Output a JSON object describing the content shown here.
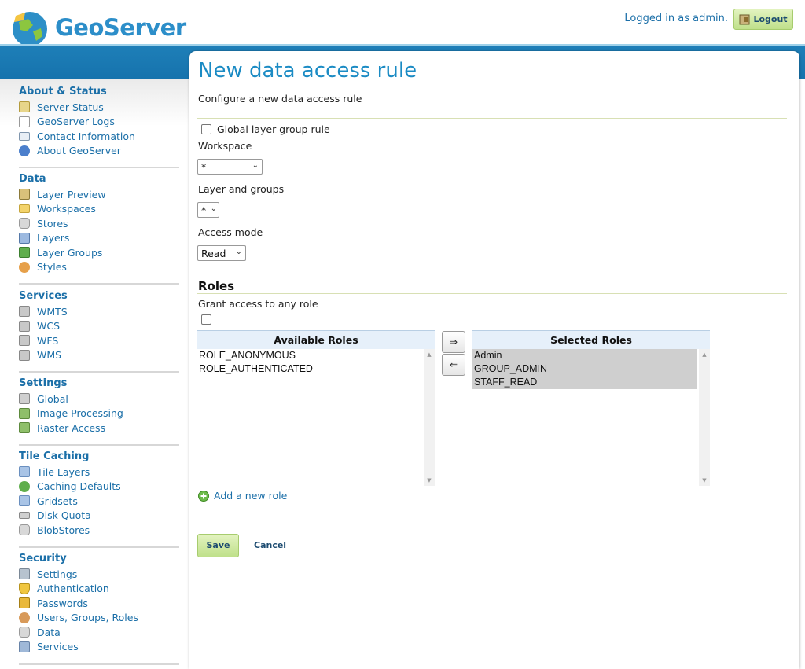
{
  "header": {
    "brand": "GeoServer",
    "login_text": "Logged in as admin.",
    "logout_label": "Logout"
  },
  "sidebar": {
    "sections": [
      {
        "title": "About & Status",
        "items": [
          {
            "label": "Server Status",
            "icon": "server-status-icon"
          },
          {
            "label": "GeoServer Logs",
            "icon": "logs-icon"
          },
          {
            "label": "Contact Information",
            "icon": "contact-card-icon"
          },
          {
            "label": "About GeoServer",
            "icon": "info-icon"
          }
        ]
      },
      {
        "title": "Data",
        "items": [
          {
            "label": "Layer Preview",
            "icon": "map-preview-icon"
          },
          {
            "label": "Workspaces",
            "icon": "folder-icon"
          },
          {
            "label": "Stores",
            "icon": "database-icon"
          },
          {
            "label": "Layers",
            "icon": "layer-icon"
          },
          {
            "label": "Layer Groups",
            "icon": "layer-group-icon"
          },
          {
            "label": "Styles",
            "icon": "palette-icon"
          }
        ]
      },
      {
        "title": "Services",
        "items": [
          {
            "label": "WMTS",
            "icon": "service-wmts-icon"
          },
          {
            "label": "WCS",
            "icon": "service-wcs-icon"
          },
          {
            "label": "WFS",
            "icon": "service-wfs-icon"
          },
          {
            "label": "WMS",
            "icon": "service-wms-icon"
          }
        ]
      },
      {
        "title": "Settings",
        "items": [
          {
            "label": "Global",
            "icon": "server-icon"
          },
          {
            "label": "Image Processing",
            "icon": "image-icon"
          },
          {
            "label": "Raster Access",
            "icon": "raster-icon"
          }
        ]
      },
      {
        "title": "Tile Caching",
        "items": [
          {
            "label": "Tile Layers",
            "icon": "grid-icon"
          },
          {
            "label": "Caching Defaults",
            "icon": "globe-icon"
          },
          {
            "label": "Gridsets",
            "icon": "gridset-icon"
          },
          {
            "label": "Disk Quota",
            "icon": "disk-icon"
          },
          {
            "label": "BlobStores",
            "icon": "blobstore-icon"
          }
        ]
      },
      {
        "title": "Security",
        "items": [
          {
            "label": "Settings",
            "icon": "wrench-icon"
          },
          {
            "label": "Authentication",
            "icon": "shield-icon"
          },
          {
            "label": "Passwords",
            "icon": "lock-icon"
          },
          {
            "label": "Users, Groups, Roles",
            "icon": "users-icon"
          },
          {
            "label": "Data",
            "icon": "data-key-icon"
          },
          {
            "label": "Services",
            "icon": "services-key-icon"
          }
        ]
      }
    ]
  },
  "main": {
    "title": "New data access rule",
    "subtitle": "Configure a new data access rule",
    "global_layer_group_label": "Global layer group rule",
    "workspace_label": "Workspace",
    "workspace_value": "*",
    "layer_label": "Layer and groups",
    "layer_value": "*",
    "access_mode_label": "Access mode",
    "access_mode_value": "Read",
    "roles_heading": "Roles",
    "grant_any_label": "Grant access to any role",
    "available_roles_header": "Available Roles",
    "available_roles": [
      "ROLE_ANONYMOUS",
      "ROLE_AUTHENTICATED"
    ],
    "selected_roles_header": "Selected Roles",
    "selected_roles": [
      "Admin",
      "GROUP_ADMIN",
      "STAFF_READ"
    ],
    "move_right_label": "⇒",
    "move_left_label": "⇐",
    "add_role_label": "Add a new role",
    "save_label": "Save",
    "cancel_label": "Cancel"
  },
  "colors": {
    "accent": "#1b8bc4",
    "link": "#1b6fa8",
    "banner": "#1673ad",
    "button_green": "#bfe08a"
  }
}
